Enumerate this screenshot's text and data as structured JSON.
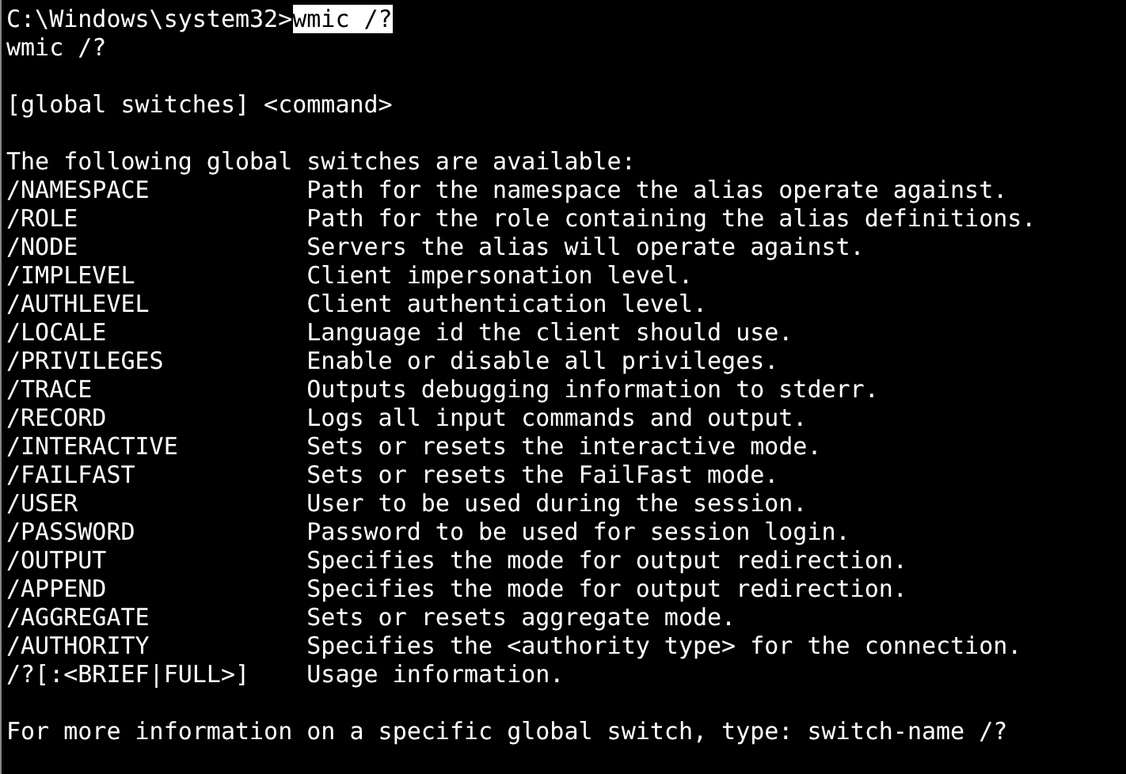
{
  "prompt": {
    "path": "C:\\Windows\\system32>",
    "command": "wmic /?",
    "selected": true
  },
  "lines": [
    {
      "kind": "text",
      "text": "wmic /?"
    },
    {
      "kind": "blank"
    },
    {
      "kind": "text",
      "text": "[global switches] <command>"
    },
    {
      "kind": "blank"
    },
    {
      "kind": "text",
      "text": "The following global switches are available:"
    },
    {
      "kind": "switch",
      "switch": "/NAMESPACE",
      "description": "Path for the namespace the alias operate against."
    },
    {
      "kind": "switch",
      "switch": "/ROLE",
      "description": "Path for the role containing the alias definitions."
    },
    {
      "kind": "switch",
      "switch": "/NODE",
      "description": "Servers the alias will operate against."
    },
    {
      "kind": "switch",
      "switch": "/IMPLEVEL",
      "description": "Client impersonation level."
    },
    {
      "kind": "switch",
      "switch": "/AUTHLEVEL",
      "description": "Client authentication level."
    },
    {
      "kind": "switch",
      "switch": "/LOCALE",
      "description": "Language id the client should use."
    },
    {
      "kind": "switch",
      "switch": "/PRIVILEGES",
      "description": "Enable or disable all privileges."
    },
    {
      "kind": "switch",
      "switch": "/TRACE",
      "description": "Outputs debugging information to stderr."
    },
    {
      "kind": "switch",
      "switch": "/RECORD",
      "description": "Logs all input commands and output."
    },
    {
      "kind": "switch",
      "switch": "/INTERACTIVE",
      "description": "Sets or resets the interactive mode."
    },
    {
      "kind": "switch",
      "switch": "/FAILFAST",
      "description": "Sets or resets the FailFast mode."
    },
    {
      "kind": "switch",
      "switch": "/USER",
      "description": "User to be used during the session."
    },
    {
      "kind": "switch",
      "switch": "/PASSWORD",
      "description": "Password to be used for session login."
    },
    {
      "kind": "switch",
      "switch": "/OUTPUT",
      "description": "Specifies the mode for output redirection."
    },
    {
      "kind": "switch",
      "switch": "/APPEND",
      "description": "Specifies the mode for output redirection."
    },
    {
      "kind": "switch",
      "switch": "/AGGREGATE",
      "description": "Sets or resets aggregate mode."
    },
    {
      "kind": "switch",
      "switch": "/AUTHORITY",
      "description": "Specifies the <authority type> for the connection."
    },
    {
      "kind": "switch",
      "switch": "/?[:<BRIEF|FULL>]",
      "description": "Usage information."
    },
    {
      "kind": "blank"
    },
    {
      "kind": "text",
      "text": "For more information on a specific global switch, type: switch-name /?"
    }
  ]
}
